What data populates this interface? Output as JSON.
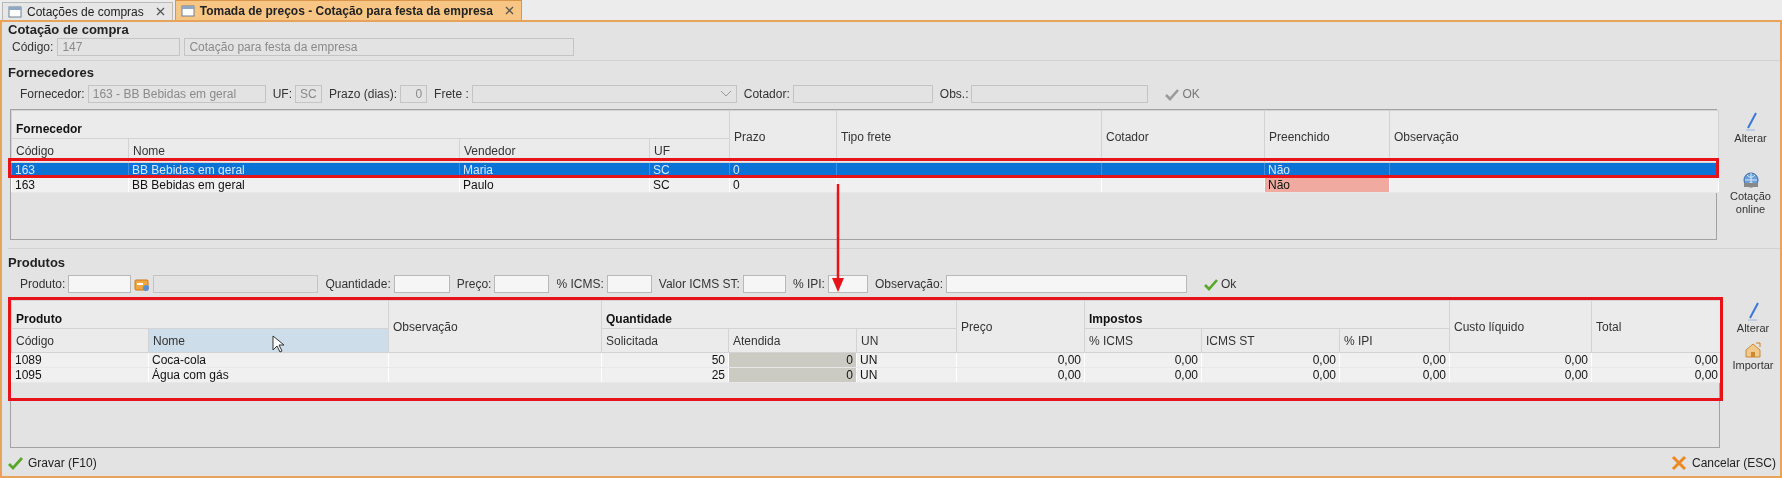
{
  "tabs": [
    {
      "label": "Cotações de compras",
      "selected": false
    },
    {
      "label": "Tomada de preços - Cotação para festa da empresa",
      "selected": true
    }
  ],
  "quote": {
    "title": "Cotação de compra",
    "fields": [
      {
        "kind": "text",
        "label": "Código:",
        "value": "147",
        "disabled": true
      },
      {
        "kind": "text",
        "value": "Cotação para festa da empresa",
        "disabled": true
      }
    ]
  },
  "suppliers": {
    "title": "Fornecedores",
    "fields": [
      {
        "kind": "text",
        "label": "Fornecedor:",
        "value": "163 - BB Bebidas em geral",
        "disabled": true
      },
      {
        "kind": "text",
        "label": "UF:",
        "value": "SC",
        "disabled": true
      },
      {
        "kind": "text",
        "label": "Prazo (dias):",
        "value": "0",
        "disabled": true
      },
      {
        "kind": "dropdown",
        "label": "Frete :",
        "disabled": true
      },
      {
        "kind": "text",
        "label": "Cotador:",
        "disabled": true
      },
      {
        "kind": "text",
        "label": "Obs.:",
        "disabled": true
      }
    ],
    "ok": {
      "label": "OK",
      "disabled": true
    },
    "table": {
      "columns": [
        {
          "group": "Fornecedor",
          "colspan": 4,
          "columns": [
            {
              "label": "Código"
            },
            {
              "label": "Nome"
            },
            {
              "label": "Vendedor"
            },
            {
              "label": "UF"
            }
          ]
        },
        {
          "label": "Prazo"
        },
        {
          "label": "Tipo frete"
        },
        {
          "label": "Cotador"
        },
        {
          "label": "Preenchido"
        },
        {
          "label": "Observação"
        }
      ],
      "rows": [
        {
          "selected": true,
          "outlined": true,
          "cells": [
            "163",
            "BB Bebidas em geral",
            "Maria",
            "SC",
            "0",
            null,
            null,
            "Não",
            null
          ]
        },
        {
          "selected": false,
          "outlined": false,
          "cells": [
            "163",
            "BB Bebidas em geral",
            "Paulo",
            "SC",
            "0",
            null,
            null,
            {
              "text": "Não",
              "flagged": true
            },
            null
          ]
        }
      ]
    },
    "actions": [
      {
        "kind": "edit",
        "label": "Alterar"
      },
      {
        "kind": "online",
        "label": "Cotação online"
      }
    ]
  },
  "callout_arrow": true,
  "products": {
    "title": "Produtos",
    "fields": [
      {
        "kind": "text",
        "label": "Produto:",
        "disabled": false
      },
      {
        "kind": "lookup"
      },
      {
        "kind": "text",
        "disabled": true
      },
      {
        "kind": "text",
        "label": "Quantidade:",
        "disabled": false
      },
      {
        "kind": "text",
        "label": "Preço:",
        "disabled": false
      },
      {
        "kind": "text",
        "label": "% ICMS:",
        "disabled": false
      },
      {
        "kind": "text",
        "label": "Valor ICMS ST:",
        "disabled": false
      },
      {
        "kind": "text",
        "label": "% IPI:",
        "disabled": false
      },
      {
        "kind": "text",
        "label": "Observação:",
        "disabled": false
      }
    ],
    "ok": {
      "label": "Ok",
      "disabled": false
    },
    "table": {
      "outlined": true,
      "columns": [
        {
          "group": "Produto",
          "colspan": 2,
          "columns": [
            {
              "label": "Código",
              "numeric": false,
              "selected": false,
              "shaded": false
            },
            {
              "label": "Nome",
              "numeric": false,
              "selected": true,
              "shaded": false
            }
          ]
        },
        {
          "label": "Observação",
          "selected": false,
          "shaded": false
        },
        {
          "group": "Quantidade",
          "colspan": 3,
          "columns": [
            {
              "label": "Solicitada",
              "numeric": true,
              "selected": false,
              "shaded": false
            },
            {
              "label": "Atendida",
              "numeric": true,
              "selected": false,
              "shaded": true
            },
            {
              "label": "UN",
              "numeric": false,
              "selected": false,
              "shaded": false
            }
          ]
        },
        {
          "label": "Preço",
          "numeric": true,
          "selected": false,
          "shaded": false
        },
        {
          "group": "Impostos",
          "colspan": 3,
          "columns": [
            {
              "label": "% ICMS",
              "numeric": true,
              "selected": false,
              "shaded": false
            },
            {
              "label": "ICMS ST",
              "numeric": true,
              "selected": false,
              "shaded": false
            },
            {
              "label": "% IPI",
              "numeric": true,
              "selected": false,
              "shaded": false
            }
          ]
        },
        {
          "label": "Custo líquido",
          "numeric": true,
          "selected": false,
          "shaded": false
        },
        {
          "label": "Total",
          "numeric": true,
          "selected": false,
          "shaded": false
        }
      ],
      "rows": [
        {
          "selected": false,
          "outlined": false,
          "cells": [
            "1089",
            "Coca-cola",
            null,
            "50",
            "0",
            "UN",
            "0,00",
            "0,00",
            "0,00",
            "0,00",
            "0,00",
            "0,00"
          ]
        },
        {
          "selected": false,
          "outlined": false,
          "cells": [
            "1095",
            "Água com gás",
            null,
            "25",
            "0",
            "UN",
            "0,00",
            "0,00",
            "0,00",
            "0,00",
            "0,00",
            "0,00"
          ]
        }
      ]
    },
    "actions": [
      {
        "kind": "edit",
        "label": "Alterar"
      },
      {
        "kind": "import",
        "label": "Importar"
      }
    ]
  },
  "footer": {
    "buttons": [
      {
        "kind": "save",
        "label": "Gravar (F10)"
      },
      {
        "kind": "cancel",
        "label": "Cancelar (ESC)"
      }
    ]
  }
}
